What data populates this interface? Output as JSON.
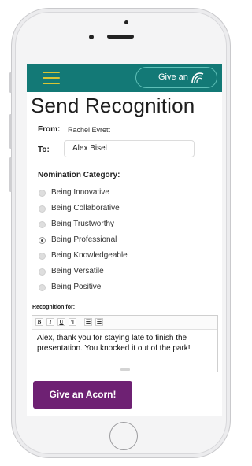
{
  "header": {
    "give_button_label": "Give an"
  },
  "page": {
    "title": "Send Recognition"
  },
  "form": {
    "from_label": "From:",
    "from_value": "Rachel Evrett",
    "to_label": "To:",
    "to_value": "Alex Bisel",
    "category_label": "Nomination Category:",
    "categories": [
      {
        "label": "Being Innovative",
        "selected": false
      },
      {
        "label": "Being Collaborative",
        "selected": false
      },
      {
        "label": "Being Trustworthy",
        "selected": false
      },
      {
        "label": "Being Professional",
        "selected": true
      },
      {
        "label": "Being Knowledgeable",
        "selected": false
      },
      {
        "label": "Being Versatile",
        "selected": false
      },
      {
        "label": "Being Positive",
        "selected": false
      }
    ],
    "recognition_label": "Recognition for:",
    "editor_toolbar": [
      "B",
      "I",
      "U",
      "¶",
      "☰",
      "☰"
    ],
    "recognition_text": "Alex, thank you for staying late to finish the presentation. You knocked it out of the park!",
    "submit_label": "Give an Acorn!"
  },
  "icons": {
    "menu": "hamburger-icon",
    "acorn": "acorn-logo-icon"
  },
  "colors": {
    "header": "#137976",
    "menu_icon": "#d8c534",
    "submit_button": "#6e2173"
  }
}
